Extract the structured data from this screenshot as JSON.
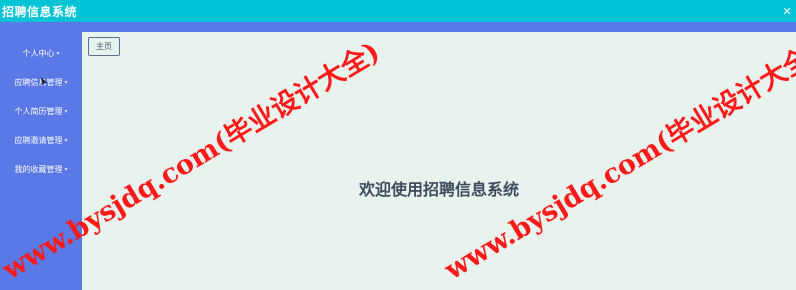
{
  "app": {
    "title": "招聘信息系统"
  },
  "window": {
    "close_glyph": "✕"
  },
  "sidebar": {
    "items": [
      {
        "label": "个人中心"
      },
      {
        "label": "应聘信息管理"
      },
      {
        "label": "个人简历管理"
      },
      {
        "label": "应聘邀请管理"
      },
      {
        "label": "我的收藏管理"
      }
    ],
    "arrow_glyph": "▾"
  },
  "main": {
    "home_button": "主页",
    "welcome": "欢迎使用招聘信息系统"
  },
  "watermark": {
    "text_1": "www.bysjdq.com(毕业设计大全)",
    "text_2": "www.bysjdq.com(毕业设计大全)"
  },
  "colors": {
    "topbar": "#00c3d6",
    "sidebar": "#5a79e6",
    "content": "#e8f3ee",
    "watermark": "#ff1a1a"
  }
}
